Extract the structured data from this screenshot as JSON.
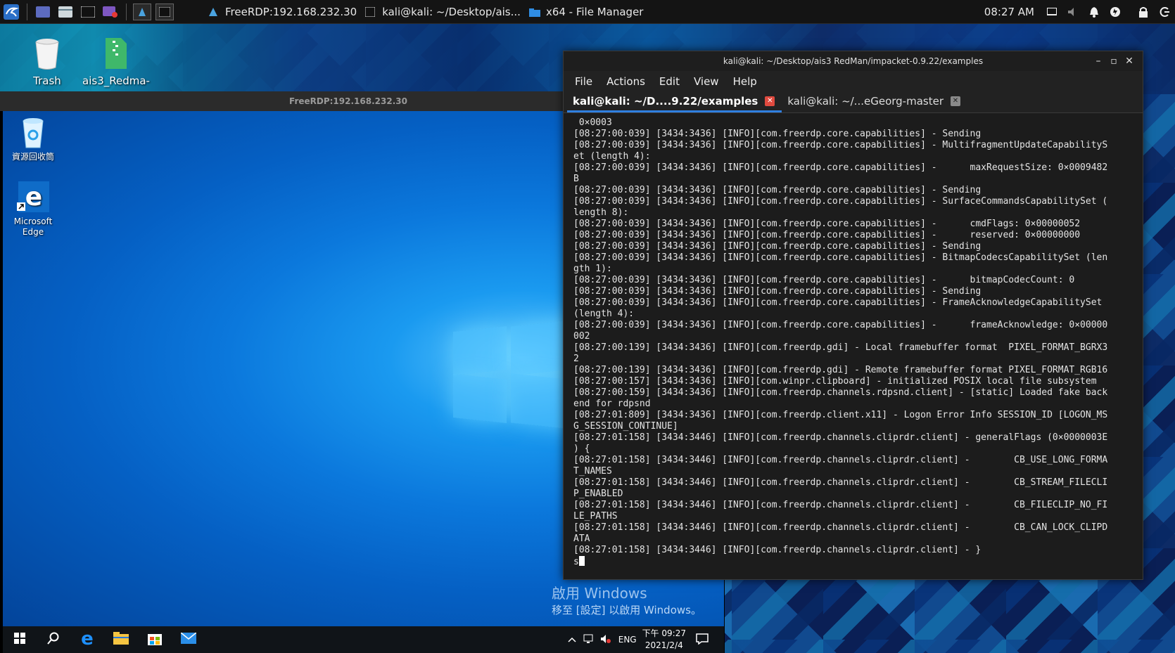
{
  "kali_panel": {
    "tasks": [
      {
        "label": "FreeRDP:192.168.232.30"
      },
      {
        "label": "kali@kali: ~/Desktop/ais..."
      },
      {
        "label": "x64 - File Manager"
      }
    ],
    "clock": "08:27 AM"
  },
  "kali_desktop": {
    "icons": [
      {
        "label": "Trash"
      },
      {
        "label": "ais3_Redma-"
      }
    ]
  },
  "rdp_window": {
    "title": "FreeRDP:192.168.232.30"
  },
  "windows_desktop": {
    "icons": [
      {
        "label": "資源回收筒"
      },
      {
        "label": "Microsoft Edge"
      }
    ],
    "activation_line1": "啟用 Windows",
    "activation_line2": "移至 [設定] 以啟用 Windows。",
    "tray_lang": "ENG",
    "tray_time": "下午 09:27",
    "tray_date": "2021/2/4"
  },
  "terminal": {
    "title": "kali@kali: ~/Desktop/ais3 RedMan/impacket-0.9.22/examples",
    "menu": [
      "File",
      "Actions",
      "Edit",
      "View",
      "Help"
    ],
    "tabs": [
      {
        "label": "kali@kali: ~/D....9.22/examples",
        "active": true
      },
      {
        "label": "kali@kali: ~/...eGeorg-master",
        "active": false
      }
    ],
    "lines": [
      " 0×0003",
      "[08:27:00:039] [3434:3436] [INFO][com.freerdp.core.capabilities] - Sending",
      "[08:27:00:039] [3434:3436] [INFO][com.freerdp.core.capabilities] - MultifragmentUpdateCapabilityS",
      "et (length 4):",
      "[08:27:00:039] [3434:3436] [INFO][com.freerdp.core.capabilities] -      maxRequestSize: 0×0009482",
      "B",
      "[08:27:00:039] [3434:3436] [INFO][com.freerdp.core.capabilities] - Sending",
      "[08:27:00:039] [3434:3436] [INFO][com.freerdp.core.capabilities] - SurfaceCommandsCapabilitySet (",
      "length 8):",
      "[08:27:00:039] [3434:3436] [INFO][com.freerdp.core.capabilities] -      cmdFlags: 0×00000052",
      "[08:27:00:039] [3434:3436] [INFO][com.freerdp.core.capabilities] -      reserved: 0×00000000",
      "[08:27:00:039] [3434:3436] [INFO][com.freerdp.core.capabilities] - Sending",
      "[08:27:00:039] [3434:3436] [INFO][com.freerdp.core.capabilities] - BitmapCodecsCapabilitySet (len",
      "gth 1):",
      "[08:27:00:039] [3434:3436] [INFO][com.freerdp.core.capabilities] -      bitmapCodecCount: 0",
      "[08:27:00:039] [3434:3436] [INFO][com.freerdp.core.capabilities] - Sending",
      "[08:27:00:039] [3434:3436] [INFO][com.freerdp.core.capabilities] - FrameAcknowledgeCapabilitySet",
      "(length 4):",
      "[08:27:00:039] [3434:3436] [INFO][com.freerdp.core.capabilities] -      frameAcknowledge: 0×00000",
      "002",
      "[08:27:00:139] [3434:3436] [INFO][com.freerdp.gdi] - Local framebuffer format  PIXEL_FORMAT_BGRX3",
      "2",
      "[08:27:00:139] [3434:3436] [INFO][com.freerdp.gdi] - Remote framebuffer format PIXEL_FORMAT_RGB16",
      "[08:27:00:157] [3434:3436] [INFO][com.winpr.clipboard] - initialized POSIX local file subsystem",
      "[08:27:00:159] [3434:3436] [INFO][com.freerdp.channels.rdpsnd.client] - [static] Loaded fake back",
      "end for rdpsnd",
      "[08:27:01:809] [3434:3436] [INFO][com.freerdp.client.x11] - Logon Error Info SESSION_ID [LOGON_MS",
      "G_SESSION_CONTINUE]",
      "[08:27:01:158] [3434:3446] [INFO][com.freerdp.channels.cliprdr.client] - generalFlags (0×0000003E",
      ") {",
      "[08:27:01:158] [3434:3446] [INFO][com.freerdp.channels.cliprdr.client] -        CB_USE_LONG_FORMA",
      "T_NAMES",
      "[08:27:01:158] [3434:3446] [INFO][com.freerdp.channels.cliprdr.client] -        CB_STREAM_FILECLI",
      "P_ENABLED",
      "[08:27:01:158] [3434:3446] [INFO][com.freerdp.channels.cliprdr.client] -        CB_FILECLIP_NO_FI",
      "LE_PATHS",
      "[08:27:01:158] [3434:3446] [INFO][com.freerdp.channels.cliprdr.client] -        CB_CAN_LOCK_CLIPD",
      "ATA",
      "[08:27:01:158] [3434:3446] [INFO][com.freerdp.channels.cliprdr.client] - }"
    ],
    "prompt_input": "s"
  }
}
